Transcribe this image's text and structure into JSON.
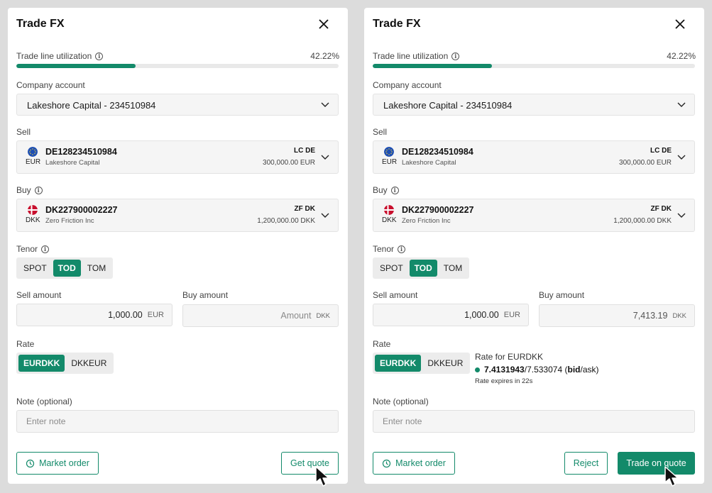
{
  "theme": {
    "accent": "#138a6a"
  },
  "panels": [
    {
      "title": "Trade FX",
      "utilization": {
        "label": "Trade line utilization",
        "value": "42.22%",
        "fraction": 0.3697
      },
      "company": {
        "label": "Company account",
        "value": "Lakeshore Capital - 234510984"
      },
      "sell": {
        "label": "Sell",
        "account": "DE128234510984",
        "currency": "EUR",
        "holder": "Lakeshore Capital",
        "code": "LC DE",
        "balance": "300,000.00 EUR",
        "flag": "eu-flag-icon"
      },
      "buy": {
        "label": "Buy",
        "account": "DK227900002227",
        "currency": "DKK",
        "holder": "Zero Friction Inc",
        "code": "ZF DK",
        "balance": "1,200,000.00 DKK",
        "flag": "dk-flag-icon"
      },
      "tenor": {
        "label": "Tenor",
        "options": [
          "SPOT",
          "TOD",
          "TOM"
        ],
        "selected": "TOD"
      },
      "sell_amount": {
        "label": "Sell amount",
        "value": "1,000.00",
        "unit": "EUR"
      },
      "buy_amount": {
        "label": "Buy amount",
        "value": "Amount",
        "unit": "DKK"
      },
      "rate": {
        "label": "Rate",
        "options": [
          "EURDKK",
          "DKKEUR"
        ],
        "selected": "EURDKK"
      },
      "note": {
        "label": "Note (optional)",
        "placeholder": "Enter note"
      },
      "buttons": {
        "market_order": "Market order",
        "get_quote": "Get quote"
      }
    },
    {
      "title": "Trade FX",
      "utilization": {
        "label": "Trade line utilization",
        "value": "42.22%",
        "fraction": 0.3697
      },
      "company": {
        "label": "Company account",
        "value": "Lakeshore Capital - 234510984"
      },
      "sell": {
        "label": "Sell",
        "account": "DE128234510984",
        "currency": "EUR",
        "holder": "Lakeshore Capital",
        "code": "LC DE",
        "balance": "300,000.00 EUR",
        "flag": "eu-flag-icon"
      },
      "buy": {
        "label": "Buy",
        "account": "DK227900002227",
        "currency": "DKK",
        "holder": "Zero Friction Inc",
        "code": "ZF DK",
        "balance": "1,200,000.00 DKK",
        "flag": "dk-flag-icon"
      },
      "tenor": {
        "label": "Tenor",
        "options": [
          "SPOT",
          "TOD",
          "TOM"
        ],
        "selected": "TOD"
      },
      "sell_amount": {
        "label": "Sell amount",
        "value": "1,000.00",
        "unit": "EUR"
      },
      "buy_amount": {
        "label": "Buy amount",
        "value": "7,413.19",
        "unit": "DKK"
      },
      "rate": {
        "label": "Rate",
        "options": [
          "EURDKK",
          "DKKEUR"
        ],
        "selected": "EURDKK"
      },
      "quote": {
        "title": "Rate for EURDKK",
        "bid": "7.4131943",
        "sep": "/",
        "ask": "7.533074",
        "paren_open": " (",
        "bid_label": "bid",
        "ask_label": "/ask)",
        "expires": "Rate expires in 22s"
      },
      "note": {
        "label": "Note (optional)",
        "placeholder": "Enter note"
      },
      "buttons": {
        "market_order": "Market order",
        "reject": "Reject",
        "trade_on_quote": "Trade on quote"
      }
    }
  ]
}
